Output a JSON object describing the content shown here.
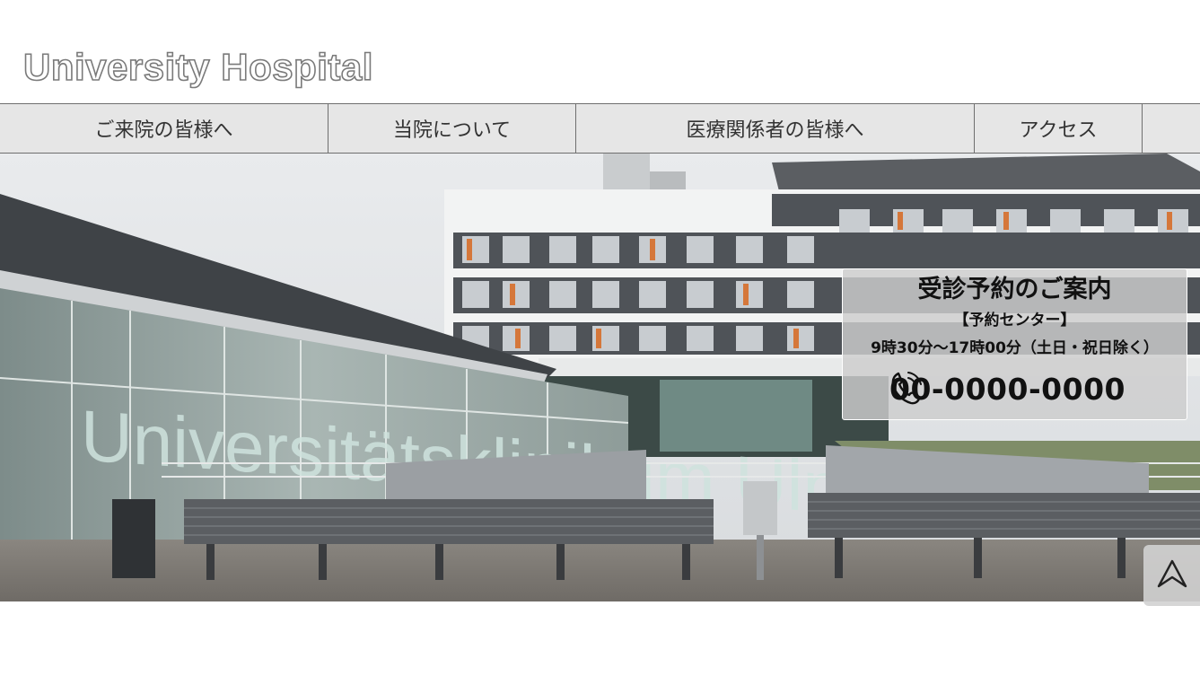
{
  "header": {
    "logo_text": "University Hospital"
  },
  "nav": {
    "items": [
      {
        "label": "ご来院の皆様へ"
      },
      {
        "label": "当院について"
      },
      {
        "label": "医療関係者の皆様へ"
      },
      {
        "label": "アクセス"
      }
    ]
  },
  "hero": {
    "building_sign": "Universitätsklinikum Ulm"
  },
  "reservation": {
    "title": "受診予約のご案内",
    "center": "【予約センター】",
    "hours": "9時30分～17時00分（土日・祝日除く）",
    "phone_icon": "phone-icon",
    "phone": "00-0000-0000"
  },
  "back_to_top": {
    "icon": "chevron-up-icon"
  },
  "colors": {
    "nav_background": "#e6e6e6",
    "nav_border": "#6f6f6f",
    "logo_outline": "#7a7a7a",
    "reservation_background": "#cdcdcd"
  }
}
